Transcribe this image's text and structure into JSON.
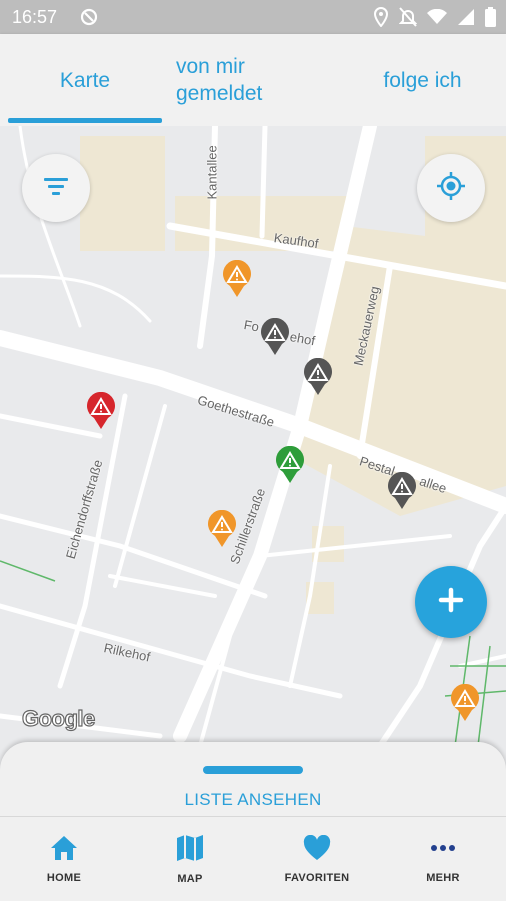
{
  "status_bar": {
    "time": "16:57"
  },
  "tabs": [
    {
      "label": "Karte"
    },
    {
      "label_line1": "von mir",
      "label_line2": "gemeldet"
    },
    {
      "label": "folge ich"
    }
  ],
  "map": {
    "streets": [
      "Kantallee",
      "Kaufhof",
      "Meckauerweg",
      "Fo",
      "ehof",
      "Goethestraße",
      "Pestal",
      "allee",
      "Eichendorffstraße",
      "Schillerstraße",
      "Rilkehof"
    ],
    "attribution": "Google"
  },
  "sheet": {
    "label": "LISTE ANSEHEN"
  },
  "nav": [
    {
      "label": "HOME",
      "icon": "home-icon"
    },
    {
      "label": "MAP",
      "icon": "map-icon"
    },
    {
      "label": "FAVORITEN",
      "icon": "heart-icon"
    },
    {
      "label": "MEHR",
      "icon": "more-icon"
    }
  ],
  "colors": {
    "accent": "#2a9fd8",
    "pin_orange": "#f0962a",
    "pin_grey": "#555555",
    "pin_red": "#d6262c",
    "pin_green": "#2e9d3a"
  }
}
